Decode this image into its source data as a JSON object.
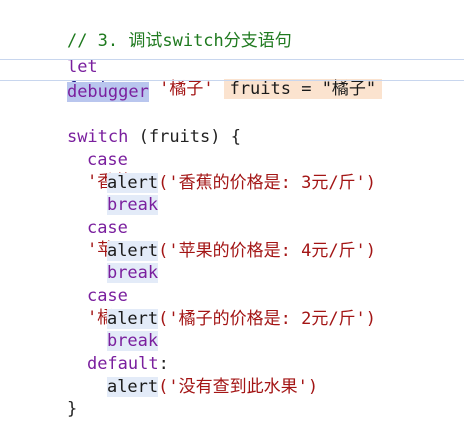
{
  "code": {
    "comment": "// 3. 调试switch分支语句",
    "let_kw": "let",
    "let_var": "fruits",
    "let_eq": " = ",
    "let_val": "'橘子'",
    "inline_value": "fruits = \"橘子\"",
    "debugger": "debugger",
    "switch_kw": "switch",
    "switch_cond": " (fruits) {",
    "cases": [
      {
        "case_kw": "case",
        "label": "'香蕉'",
        "alert": "alert",
        "msg": "('香蕉的价格是: 3元/斤')",
        "break": "break"
      },
      {
        "case_kw": "case",
        "label": "'苹果'",
        "alert": "alert",
        "msg": "('苹果的价格是: 4元/斤')",
        "break": "break"
      },
      {
        "case_kw": "case",
        "label": "'橘子'",
        "alert": "alert",
        "msg": "('橘子的价格是: 2元/斤')",
        "break": "break"
      }
    ],
    "default_kw": "default",
    "default_alert": "alert",
    "default_msg": "('没有查到此水果')",
    "close_brace": "}",
    "colon": ":"
  }
}
